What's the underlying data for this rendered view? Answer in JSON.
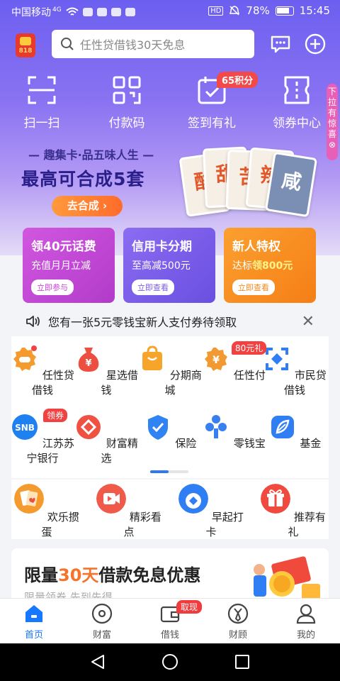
{
  "status": {
    "carrier": "中国移动",
    "network": "4G",
    "battery": "78%",
    "time": "15:45"
  },
  "search": {
    "placeholder": "任性贷借钱30天免息"
  },
  "logo": {
    "text": "818"
  },
  "quick_actions": [
    {
      "label": "扫一扫",
      "icon": "scan-icon"
    },
    {
      "label": "付款码",
      "icon": "qrcode-icon"
    },
    {
      "label": "签到有礼",
      "icon": "calendar-check-icon"
    },
    {
      "label": "领券中心",
      "icon": "coupon-icon"
    }
  ],
  "points_badge": "65积分",
  "side_tab": {
    "chars": [
      "下",
      "拉",
      "有",
      "惊",
      "喜"
    ]
  },
  "banner": {
    "subtitle": "趣集卡·品五味人生",
    "title": "最高可合成5套",
    "button": "去合成",
    "cards": [
      "酸",
      "甜",
      "苦",
      "辣",
      "咸"
    ]
  },
  "promos": [
    {
      "title": "领40元话费",
      "sub": "充值月月立减",
      "highlight": "",
      "btn": "立即参与",
      "color": "#c945d6"
    },
    {
      "title": "信用卡分期",
      "sub": "至高减500元",
      "highlight": "",
      "btn": "立即查看",
      "color": "#7b5bea"
    },
    {
      "title": "新人特权",
      "sub": "达标",
      "highlight": "领800元",
      "btn": "立即查看",
      "color": "#f58a1f"
    }
  ],
  "notice": {
    "text": "您有一张5元零钱宝新人支付券待领取"
  },
  "grid": [
    {
      "label": "任性贷借钱",
      "icon": "loan-icon",
      "color": "#f59a2c"
    },
    {
      "label": "星选借钱",
      "icon": "money-bag-icon",
      "color": "#ec4f3f"
    },
    {
      "label": "分期商城",
      "icon": "shopping-bag-icon",
      "color": "#f6a52a"
    },
    {
      "label": "任性付",
      "icon": "pay-icon",
      "color": "#f29a32"
    },
    {
      "label": "市民贷借钱",
      "icon": "citizen-loan-icon",
      "color": "#2f7ef4"
    },
    {
      "label": "江苏苏宁银行",
      "icon": "snb-icon",
      "color": "#1f80f0"
    },
    {
      "label": "财富精选",
      "icon": "wealth-icon",
      "color": "#ef5242"
    },
    {
      "label": "保险",
      "icon": "shield-icon",
      "color": "#2f83f2"
    },
    {
      "label": "零钱宝",
      "icon": "lingqianbao-icon",
      "color": "#3880f0"
    },
    {
      "label": "基金",
      "icon": "fund-icon",
      "color": "#2f7ef4"
    }
  ],
  "grid_tags": {
    "t80": "80元礼",
    "snb": "领券"
  },
  "snb_text": "SNB",
  "row2": [
    {
      "label": "欢乐掼蛋",
      "icon": "cards-game-icon",
      "color": "#f59a2c"
    },
    {
      "label": "精彩看点",
      "icon": "video-icon",
      "color": "#f05a4a"
    },
    {
      "label": "早起打卡",
      "icon": "checkin-icon",
      "color": "#2f7ef4"
    },
    {
      "label": "推荐有礼",
      "icon": "gift-icon",
      "color": "#f04a3e"
    }
  ],
  "ad": {
    "pre": "限量",
    "num": "30天",
    "post": "借款免息优惠",
    "sub": "限量领券 先到先得"
  },
  "tabs": [
    {
      "label": "首页",
      "icon": "home-icon"
    },
    {
      "label": "财富",
      "icon": "wealth-coin-icon"
    },
    {
      "label": "借钱",
      "icon": "borrow-icon"
    },
    {
      "label": "财顾",
      "icon": "advisor-icon"
    },
    {
      "label": "我的",
      "icon": "profile-icon"
    }
  ],
  "tab_badge": "取现",
  "colors": {
    "accent": "#1677ff",
    "hero": "#6c5ff0"
  }
}
